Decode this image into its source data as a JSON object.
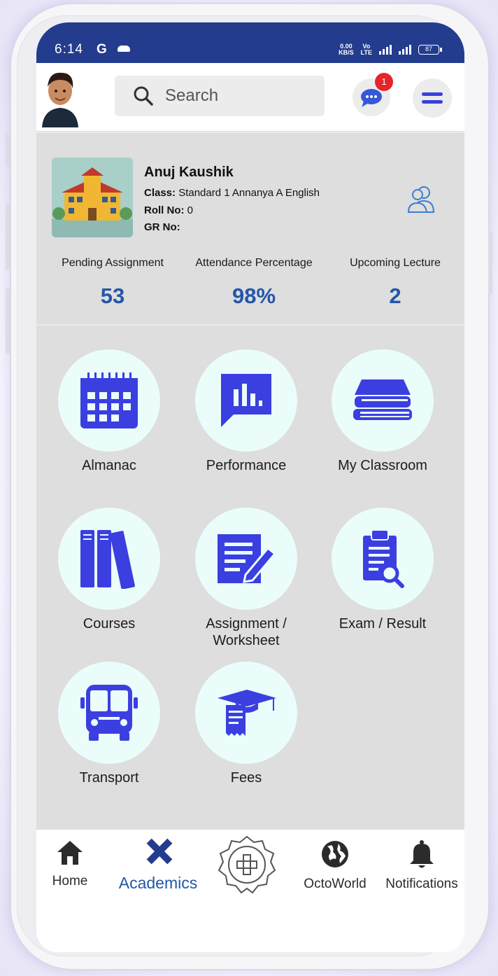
{
  "status_bar": {
    "time": "6:14",
    "carrier_icon": "G",
    "net_speed": "0.00 KB/S",
    "volte": "VoLTE",
    "battery": "87"
  },
  "header": {
    "search_placeholder": "Search",
    "chat_badge_count": "1"
  },
  "profile": {
    "name": "Anuj Kaushik",
    "class_label": "Class:",
    "class_value": " Standard 1 Annanya A English",
    "roll_label": "Roll No:",
    "roll_value": " 0",
    "gr_label": "GR No:",
    "gr_value": ""
  },
  "stats": [
    {
      "label": "Pending Assignment",
      "value": "53"
    },
    {
      "label": "Attendance Percentage",
      "value": "98%"
    },
    {
      "label": "Upcoming Lecture",
      "value": "2"
    }
  ],
  "tiles": [
    {
      "label": "Almanac",
      "icon": "calendar-icon"
    },
    {
      "label": "Performance",
      "icon": "chart-bubble-icon"
    },
    {
      "label": "My Classroom",
      "icon": "books-stack-icon"
    },
    {
      "label": "Courses",
      "icon": "binders-icon"
    },
    {
      "label": "Assignment / Worksheet",
      "icon": "document-edit-icon"
    },
    {
      "label": "Exam / Result",
      "icon": "clipboard-search-icon"
    },
    {
      "label": "Transport",
      "icon": "bus-icon"
    },
    {
      "label": "Fees",
      "icon": "fee-receipt-icon"
    }
  ],
  "bottom_nav": [
    {
      "label": "Home",
      "icon": "home-icon",
      "active": false
    },
    {
      "label": "Academics",
      "icon": "pencil-ruler-icon",
      "active": true
    },
    {
      "label": "",
      "icon": "add-badge-icon",
      "active": false
    },
    {
      "label": "OctoWorld",
      "icon": "globe-icon",
      "active": false
    },
    {
      "label": "Notifications",
      "icon": "bell-icon",
      "active": false
    }
  ],
  "colors": {
    "status_bar": "#233c8e",
    "accent_blue": "#2456a8",
    "icon_blue": "#3b3fe0",
    "tile_bg": "#eafdfb",
    "content_bg": "#dedede",
    "badge_red": "#e5252a"
  }
}
